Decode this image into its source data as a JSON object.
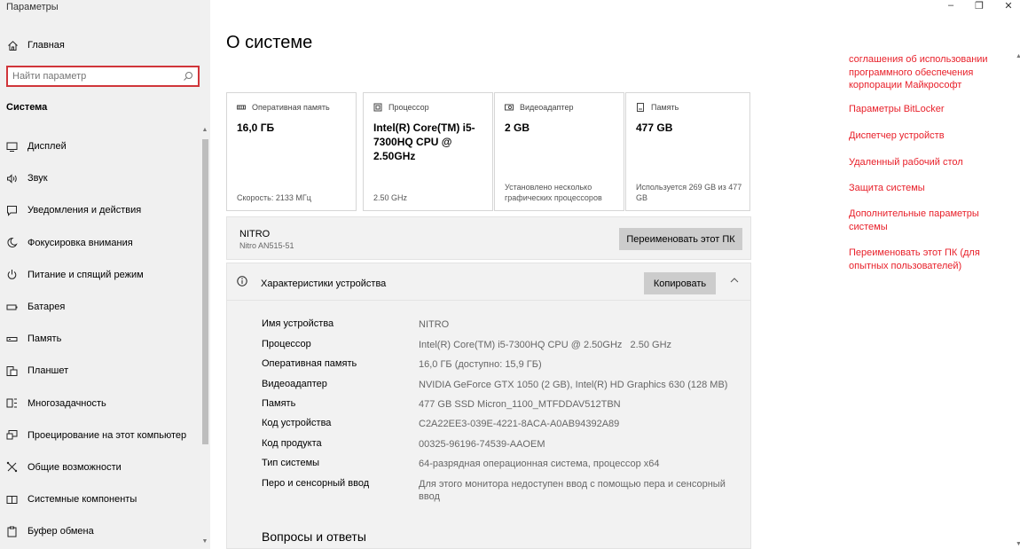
{
  "window": {
    "title": "Параметры",
    "minimize": "–",
    "restore": "❐",
    "close": "✕"
  },
  "sidebar": {
    "home_label": "Главная",
    "search_placeholder": "Найти параметр",
    "section_title": "Система",
    "items": [
      {
        "label": "Дисплей",
        "icon": "display-icon"
      },
      {
        "label": "Звук",
        "icon": "sound-icon"
      },
      {
        "label": "Уведомления и действия",
        "icon": "notifications-icon"
      },
      {
        "label": "Фокусировка внимания",
        "icon": "focus-assist-icon"
      },
      {
        "label": "Питание и спящий режим",
        "icon": "power-icon"
      },
      {
        "label": "Батарея",
        "icon": "battery-icon"
      },
      {
        "label": "Память",
        "icon": "storage-icon"
      },
      {
        "label": "Планшет",
        "icon": "tablet-icon"
      },
      {
        "label": "Многозадачность",
        "icon": "multitasking-icon"
      },
      {
        "label": "Проецирование на этот компьютер",
        "icon": "projecting-icon"
      },
      {
        "label": "Общие возможности",
        "icon": "shared-experiences-icon"
      },
      {
        "label": "Системные компоненты",
        "icon": "system-components-icon"
      },
      {
        "label": "Буфер обмена",
        "icon": "clipboard-icon"
      }
    ]
  },
  "main": {
    "title": "О системе",
    "cards": [
      {
        "head": "Оперативная память",
        "value": "16,0 ГБ",
        "foot": "Скорость: 2133 МГц",
        "icon": "ram-icon"
      },
      {
        "head": "Процессор",
        "value": "Intel(R) Core(TM) i5-7300HQ CPU @ 2.50GHz",
        "foot": "2.50 GHz",
        "icon": "cpu-icon"
      },
      {
        "head": "Видеоадаптер",
        "value": "2 GB",
        "foot": "Установлено несколько графических процессоров",
        "icon": "gpu-icon"
      },
      {
        "head": "Память",
        "value": "477 GB",
        "foot": "Используется 269 GB из 477 GB",
        "icon": "storage-card-icon"
      }
    ],
    "pc": {
      "name": "NITRO",
      "model": "Nitro AN515-51",
      "rename_button": "Переименовать этот ПК"
    },
    "specs": {
      "title": "Характеристики устройства",
      "copy_button": "Копировать",
      "rows": [
        {
          "label": "Имя устройства",
          "value": "NITRO"
        },
        {
          "label": "Процессор",
          "value": "Intel(R) Core(TM) i5-7300HQ CPU @ 2.50GHz   2.50 GHz"
        },
        {
          "label": "Оперативная память",
          "value": "16,0 ГБ (доступно: 15,9 ГБ)"
        },
        {
          "label": "Видеоадаптер",
          "value": "NVIDIA GeForce GTX 1050 (2 GB), Intel(R) HD Graphics 630 (128 MB)"
        },
        {
          "label": "Память",
          "value": "477 GB SSD Micron_1100_MTFDDAV512TBN"
        },
        {
          "label": "Код устройства",
          "value": "C2A22EE3-039E-4221-8ACA-A0AB94392A89"
        },
        {
          "label": "Код продукта",
          "value": "00325-96196-74539-AAOEM"
        },
        {
          "label": "Тип системы",
          "value": "64-разрядная операционная система, процессор x64"
        },
        {
          "label": "Перо и сенсорный ввод",
          "value": "Для этого монитора недоступен ввод с помощью пера и сенсорный ввод"
        }
      ]
    },
    "faq_title": "Вопросы и ответы"
  },
  "links": [
    "соглашения об использовании программного обеспечения корпорации Майкрософт",
    "Параметры BitLocker",
    "Диспетчер устройств",
    "Удаленный рабочий стол",
    "Защита системы",
    "Дополнительные параметры системы",
    "Переименовать этот ПК (для опытных пользователей)"
  ],
  "colors": {
    "link": "#e8202a",
    "search_border": "#d0353a",
    "sidebar_bg": "#f0f0f0",
    "button_bg": "#cccccc"
  }
}
